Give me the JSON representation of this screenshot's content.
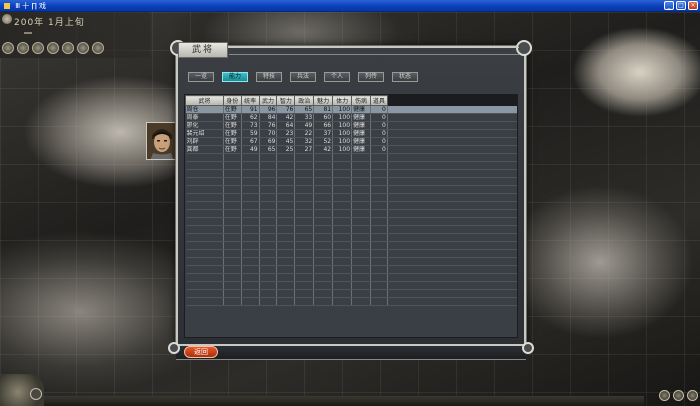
{
  "window": {
    "title": "Ⅲ 十 ∏ 戏",
    "min_label": "_",
    "max_label": "□",
    "close_label": "×"
  },
  "hud": {
    "date": "200年 1月上旬",
    "sub_left": "",
    "sub_box": ""
  },
  "panel": {
    "title": "武将"
  },
  "tabs": [
    {
      "label": "一览"
    },
    {
      "label": "能力"
    },
    {
      "label": "特技"
    },
    {
      "label": "兵法"
    },
    {
      "label": "个人"
    },
    {
      "label": "列传"
    },
    {
      "label": "状态"
    }
  ],
  "active_tab_index": 1,
  "table": {
    "headers": [
      "武将",
      "身份",
      "统率",
      "武力",
      "智力",
      "政治",
      "魅力",
      "体力",
      "伤病",
      "道具"
    ],
    "rows": [
      [
        "周仓",
        "在野",
        "91",
        "96",
        "76",
        "65",
        "81",
        "100",
        "健康",
        "0"
      ],
      [
        "周泰",
        "在野",
        "62",
        "84",
        "42",
        "33",
        "60",
        "100",
        "健康",
        "0"
      ],
      [
        "廖化",
        "在野",
        "73",
        "76",
        "64",
        "49",
        "66",
        "100",
        "健康",
        "0"
      ],
      [
        "裴元绍",
        "在野",
        "59",
        "70",
        "23",
        "22",
        "37",
        "100",
        "健康",
        "0"
      ],
      [
        "刘辟",
        "在野",
        "67",
        "69",
        "45",
        "32",
        "52",
        "100",
        "健康",
        "0"
      ],
      [
        "龚都",
        "在野",
        "49",
        "65",
        "25",
        "27",
        "42",
        "100",
        "健康",
        "0"
      ]
    ],
    "selected_row": 0,
    "empty_rows": 19
  },
  "buttons": {
    "back": "返回"
  }
}
